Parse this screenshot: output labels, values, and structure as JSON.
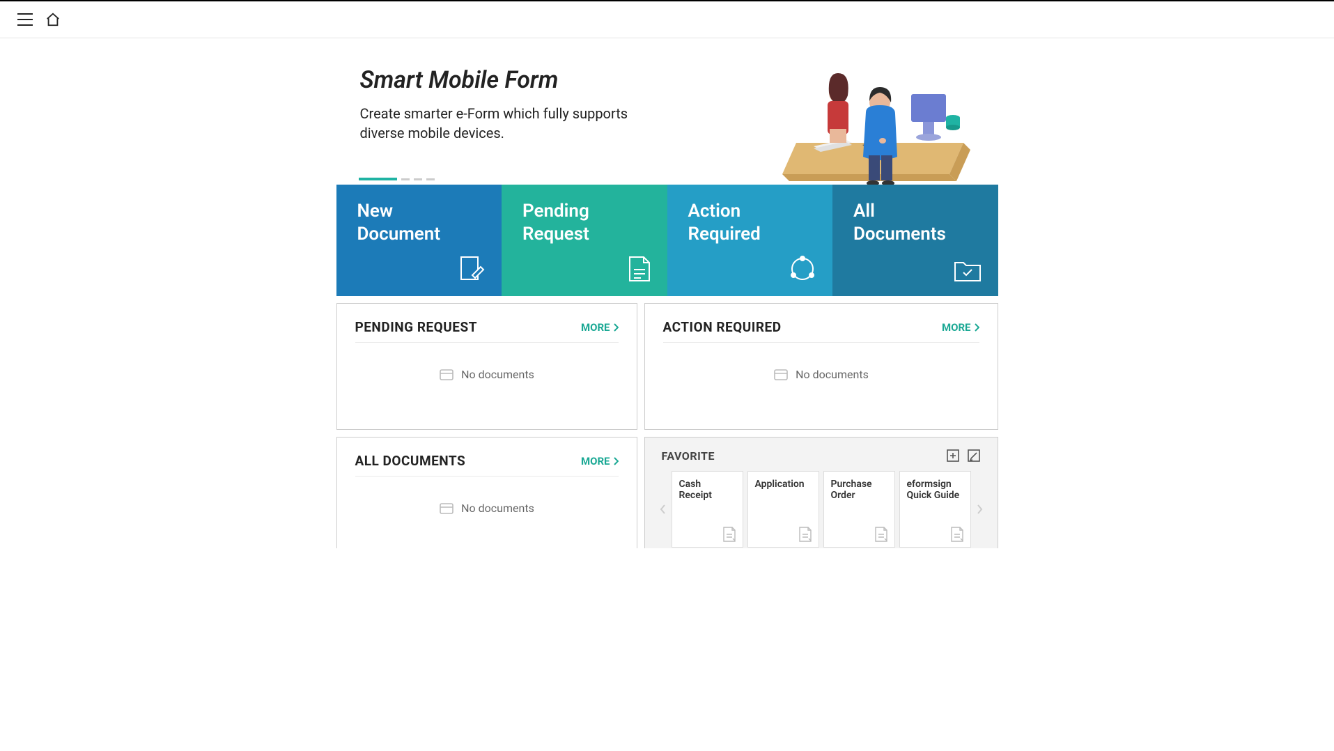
{
  "hero": {
    "title": "Smart Mobile Form",
    "subtitle": "Create smarter e-Form which fully supports diverse mobile devices."
  },
  "tiles": [
    {
      "line1": "New",
      "line2": "Document"
    },
    {
      "line1": "Pending",
      "line2": "Request"
    },
    {
      "line1": "Action",
      "line2": "Required"
    },
    {
      "line1": "All",
      "line2": "Documents"
    }
  ],
  "panels": {
    "pending": {
      "title": "PENDING REQUEST",
      "more": "MORE",
      "empty": "No documents"
    },
    "action": {
      "title": "ACTION REQUIRED",
      "more": "MORE",
      "empty": "No documents"
    },
    "all": {
      "title": "ALL DOCUMENTS",
      "more": "MORE",
      "empty": "No documents"
    }
  },
  "favorite": {
    "title": "FAVORITE",
    "items": [
      {
        "label": "Cash Receipt"
      },
      {
        "label": "Application"
      },
      {
        "label": "Purchase Order"
      },
      {
        "label": "eformsign Quick Guide"
      }
    ]
  }
}
